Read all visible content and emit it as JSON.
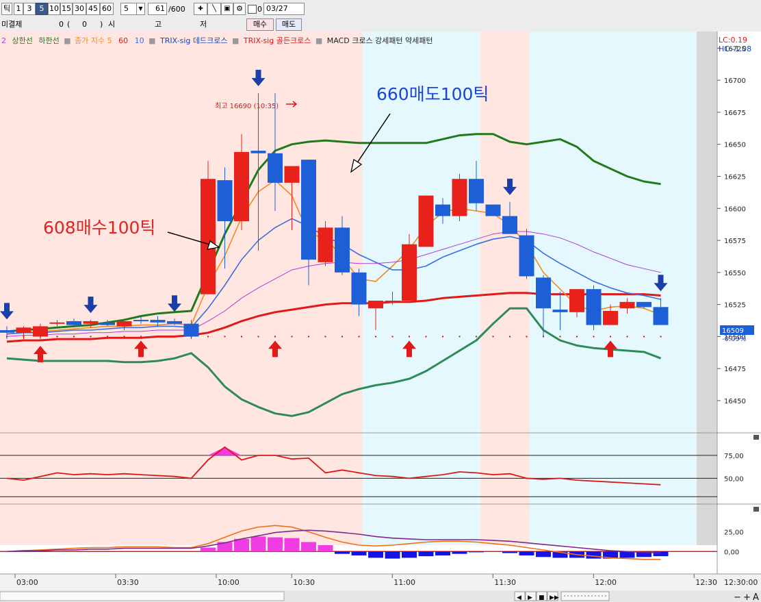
{
  "toolbar": {
    "tick_label": "틱",
    "intervals": [
      "1",
      "3",
      "5",
      "10",
      "15",
      "30",
      "45",
      "60"
    ],
    "selected_interval": "5",
    "count_value": "5",
    "position_value": "61",
    "position_total": "/600",
    "checkbox_label": "0",
    "date_value": "03/27"
  },
  "infobar": {
    "unsettled_label": "미결제",
    "unsettled_value": "0",
    "paren_open": "(",
    "paren_value": "0",
    "paren_close": ")",
    "open_label": "시",
    "high_label": "고",
    "low_label": "저",
    "buy_button": "매수",
    "sell_button": "매도"
  },
  "legend": {
    "prefix": "2",
    "upper_band": "상한선",
    "lower_band": "하한선",
    "close_index": "종가 지수 5",
    "ma60": "60",
    "ma10": "10",
    "trix_dead": "TRIX-sig 데드크로스",
    "trix_golden": "TRIX-sig 골든크로스",
    "macd_text": "MACD 크로스 강세패턴  약세패턴"
  },
  "price_info": {
    "lc": "LC:0.19",
    "hc": "HC:-1.08",
    "current_price": "16509",
    "current_change": "-0.09%",
    "high_marker": "최고 16690 (10:35)"
  },
  "annotations": {
    "buy_note": "608매수100틱",
    "sell_note": "660매도100틱"
  },
  "colors": {
    "up_candle": "#e8211a",
    "down_candle": "#1c5fd6",
    "bollinger": "#217a1a",
    "ma60": "#e01919",
    "close_index_line": "#f08c1e",
    "ma10": "#3a6ee0",
    "ma_extra": "#b23ad8",
    "sell_arrow": "#1a3fa8",
    "buy_arrow": "#e01919",
    "bg_pink": "#ffe6e1",
    "bg_cyan": "#e4f8fd"
  },
  "navigation": {
    "controls": [
      "◀",
      "▶",
      "■",
      "▶▶"
    ],
    "zoom_controls": [
      "−",
      "+",
      "A"
    ]
  },
  "chart_data": [
    {
      "type": "candlestick",
      "x_ticks": [
        "03:00",
        "03:30",
        "10:00",
        "10:30",
        "11:00",
        "11:30",
        "12:00",
        "12:30",
        "12:30:00"
      ],
      "y_ticks": [
        16725,
        16700,
        16675,
        16650,
        16625,
        16600,
        16575,
        16550,
        16525,
        16500,
        16475,
        16450
      ],
      "ylim": [
        16427,
        16730
      ],
      "candles": [
        {
          "o": 16505,
          "h": 16508,
          "l": 16498,
          "c": 16503
        },
        {
          "o": 16503,
          "h": 16508,
          "l": 16498,
          "c": 16507
        },
        {
          "o": 16500,
          "h": 16510,
          "l": 16497,
          "c": 16508
        },
        {
          "o": 16510,
          "h": 16513,
          "l": 16507,
          "c": 16511
        },
        {
          "o": 16512,
          "h": 16514,
          "l": 16508,
          "c": 16509
        },
        {
          "o": 16510,
          "h": 16513,
          "l": 16507,
          "c": 16512
        },
        {
          "o": 16511,
          "h": 16513,
          "l": 16508,
          "c": 16509
        },
        {
          "o": 16508,
          "h": 16512,
          "l": 16505,
          "c": 16512
        },
        {
          "o": 16513,
          "h": 16516,
          "l": 16510,
          "c": 16512
        },
        {
          "o": 16513,
          "h": 16516,
          "l": 16508,
          "c": 16511
        },
        {
          "o": 16512,
          "h": 16514,
          "l": 16509,
          "c": 16510
        },
        {
          "o": 16510,
          "h": 16513,
          "l": 16498,
          "c": 16500
        },
        {
          "o": 16533,
          "h": 16637,
          "l": 16533,
          "c": 16623
        },
        {
          "o": 16622,
          "h": 16632,
          "l": 16553,
          "c": 16590
        },
        {
          "o": 16590,
          "h": 16658,
          "l": 16583,
          "c": 16644
        },
        {
          "o": 16645,
          "h": 16690,
          "l": 16567,
          "c": 16643
        },
        {
          "o": 16643,
          "h": 16690,
          "l": 16598,
          "c": 16620
        },
        {
          "o": 16620,
          "h": 16633,
          "l": 16583,
          "c": 16633
        },
        {
          "o": 16638,
          "h": 16638,
          "l": 16540,
          "c": 16560
        },
        {
          "o": 16558,
          "h": 16590,
          "l": 16555,
          "c": 16585
        },
        {
          "o": 16585,
          "h": 16594,
          "l": 16548,
          "c": 16550
        },
        {
          "o": 16550,
          "h": 16553,
          "l": 16516,
          "c": 16525
        },
        {
          "o": 16522,
          "h": 16528,
          "l": 16505,
          "c": 16528
        },
        {
          "o": 16528,
          "h": 16535,
          "l": 16525,
          "c": 16528
        },
        {
          "o": 16528,
          "h": 16580,
          "l": 16528,
          "c": 16572
        },
        {
          "o": 16570,
          "h": 16610,
          "l": 16570,
          "c": 16610
        },
        {
          "o": 16603,
          "h": 16608,
          "l": 16588,
          "c": 16594
        },
        {
          "o": 16594,
          "h": 16627,
          "l": 16590,
          "c": 16623
        },
        {
          "o": 16623,
          "h": 16637,
          "l": 16598,
          "c": 16604
        },
        {
          "o": 16603,
          "h": 16603,
          "l": 16594,
          "c": 16594
        },
        {
          "o": 16594,
          "h": 16605,
          "l": 16583,
          "c": 16580
        },
        {
          "o": 16579,
          "h": 16584,
          "l": 16545,
          "c": 16547
        },
        {
          "o": 16546,
          "h": 16548,
          "l": 16500,
          "c": 16522
        },
        {
          "o": 16521,
          "h": 16535,
          "l": 16505,
          "c": 16519
        },
        {
          "o": 16519,
          "h": 16537,
          "l": 16515,
          "c": 16537
        },
        {
          "o": 16537,
          "h": 16540,
          "l": 16505,
          "c": 16509
        },
        {
          "o": 16509,
          "h": 16525,
          "l": 16509,
          "c": 16520
        },
        {
          "o": 16522,
          "h": 16530,
          "l": 16518,
          "c": 16527
        },
        {
          "o": 16527,
          "h": 16527,
          "l": 16522,
          "c": 16523
        },
        {
          "o": 16523,
          "h": 16530,
          "l": 16509,
          "c": 16509
        }
      ],
      "series": [
        {
          "name": "상한선",
          "values": [
            16504,
            16505,
            16506,
            16507,
            16508,
            16509,
            16511,
            16513,
            16516,
            16518,
            16519,
            16520,
            16550,
            16580,
            16605,
            16630,
            16645,
            16650,
            16652,
            16653,
            16652,
            16651,
            16651,
            16651,
            16651,
            16651,
            16654,
            16657,
            16658,
            16658,
            16652,
            16650,
            16652,
            16654,
            16648,
            16637,
            16631,
            16625,
            16621,
            16619
          ]
        },
        {
          "name": "하한선",
          "values": [
            16483,
            16482,
            16481,
            16481,
            16481,
            16481,
            16481,
            16480,
            16480,
            16481,
            16483,
            16487,
            16476,
            16461,
            16451,
            16445,
            16440,
            16438,
            16441,
            16448,
            16455,
            16459,
            16462,
            16464,
            16467,
            16473,
            16481,
            16489,
            16497,
            16510,
            16522,
            16522,
            16505,
            16497,
            16493,
            16491,
            16490,
            16489,
            16488,
            16483
          ]
        },
        {
          "name": "60",
          "values": [
            16496,
            16497,
            16497,
            16498,
            16498,
            16498,
            16499,
            16499,
            16499,
            16500,
            16500,
            16501,
            16503,
            16507,
            16512,
            16516,
            16519,
            16521,
            16523,
            16525,
            16526,
            16526,
            16526,
            16527,
            16527,
            16528,
            16530,
            16531,
            16532,
            16533,
            16534,
            16534,
            16533,
            16533,
            16533,
            16533,
            16533,
            16533,
            16533,
            16532
          ]
        },
        {
          "name": "5",
          "values": [
            16502,
            16503,
            16504,
            16505,
            16506,
            16507,
            16508,
            16508,
            16509,
            16509,
            16510,
            16509,
            16540,
            16563,
            16593,
            16613,
            16622,
            16610,
            16580,
            16577,
            16562,
            16545,
            16543,
            16555,
            16568,
            16586,
            16597,
            16600,
            16598,
            16596,
            16587,
            16572,
            16550,
            16537,
            16524,
            16520,
            16523,
            16524,
            16522,
            16517
          ]
        },
        {
          "name": "10",
          "values": [
            16502,
            16503,
            16503,
            16504,
            16505,
            16505,
            16506,
            16507,
            16507,
            16508,
            16508,
            16507,
            16522,
            16540,
            16560,
            16575,
            16585,
            16592,
            16586,
            16578,
            16572,
            16564,
            16558,
            16552,
            16552,
            16555,
            16562,
            16567,
            16572,
            16576,
            16578,
            16575,
            16565,
            16557,
            16550,
            16543,
            16538,
            16534,
            16532,
            16529
          ]
        },
        {
          "name": "extra",
          "values": [
            16500,
            16501,
            16501,
            16502,
            16502,
            16503,
            16503,
            16504,
            16504,
            16505,
            16505,
            16505,
            16512,
            16520,
            16530,
            16538,
            16545,
            16552,
            16555,
            16557,
            16558,
            16557,
            16557,
            16558,
            16560,
            16564,
            16568,
            16572,
            16576,
            16580,
            16582,
            16582,
            16580,
            16577,
            16572,
            16566,
            16561,
            16556,
            16553,
            16550
          ]
        }
      ],
      "sell_signal_bars": [
        0,
        5,
        10,
        15,
        30,
        41
      ],
      "buy_signal_bars": [
        2,
        8,
        16,
        24,
        36
      ],
      "dot_markers": true
    },
    {
      "type": "line",
      "name": "oscillator",
      "y_ticks": [
        "75,00",
        "50,00"
      ],
      "ylim": [
        25,
        95
      ],
      "reference_lines": [
        75,
        50,
        30
      ],
      "values": [
        50,
        48,
        52,
        56,
        54,
        55,
        54,
        55,
        54,
        53,
        52,
        50,
        70,
        84,
        70,
        75,
        75,
        71,
        72,
        56,
        59,
        56,
        53,
        52,
        50,
        52,
        54,
        57,
        56,
        54,
        55,
        50,
        49,
        50,
        48,
        47,
        46,
        45,
        44,
        43
      ]
    },
    {
      "type": "bar",
      "name": "MACD",
      "y_ticks": [
        "25,00",
        "0,00"
      ],
      "ylim": [
        -25,
        55
      ],
      "hist": [
        0,
        0,
        0,
        0,
        0,
        0,
        0,
        0,
        0,
        0,
        0,
        0,
        5,
        12,
        16,
        19,
        18,
        17,
        12,
        8,
        -3,
        -5,
        -8,
        -9,
        -8,
        -6,
        -5,
        -3,
        -1,
        0,
        -2,
        -5,
        -7,
        -8,
        -8,
        -9,
        -9,
        -8,
        -7,
        -6
      ],
      "line1": [
        0,
        1,
        2,
        3,
        4,
        5,
        5,
        6,
        6,
        6,
        5,
        5,
        10,
        18,
        26,
        31,
        33,
        31,
        25,
        18,
        12,
        8,
        7,
        8,
        10,
        12,
        13,
        13,
        12,
        10,
        8,
        5,
        2,
        -1,
        -4,
        -6,
        -8,
        -9,
        -10,
        -10
      ],
      "line2": [
        0,
        1,
        1,
        2,
        2,
        3,
        3,
        4,
        4,
        4,
        4,
        4,
        7,
        11,
        16,
        20,
        24,
        26,
        27,
        26,
        24,
        22,
        19,
        17,
        16,
        15,
        15,
        15,
        15,
        14,
        13,
        11,
        9,
        7,
        5,
        3,
        1,
        0,
        -1,
        -2
      ]
    }
  ]
}
